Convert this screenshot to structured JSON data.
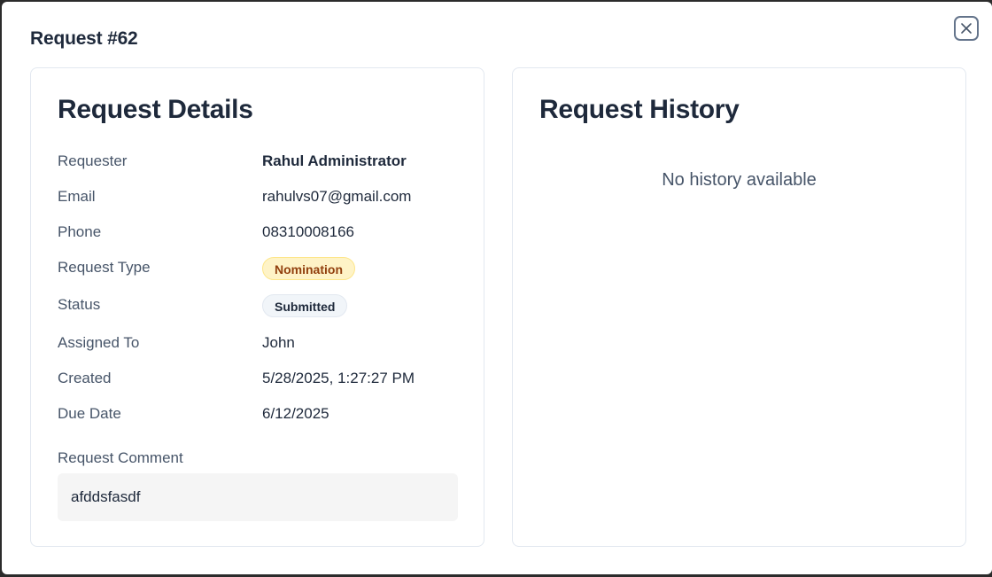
{
  "modal": {
    "title": "Request #62",
    "close_icon": "close-icon"
  },
  "details": {
    "title": "Request Details",
    "rows": [
      {
        "label": "Requester",
        "value": "Rahul Administrator"
      },
      {
        "label": "Email",
        "value": "rahulvs07@gmail.com"
      },
      {
        "label": "Phone",
        "value": "08310008166"
      },
      {
        "label": "Request Type",
        "value": "Nomination"
      },
      {
        "label": "Status",
        "value": "Submitted"
      },
      {
        "label": "Assigned To",
        "value": "John"
      },
      {
        "label": "Created",
        "value": "5/28/2025, 1:27:27 PM"
      },
      {
        "label": "Due Date",
        "value": "6/12/2025"
      }
    ],
    "comment_label": "Request Comment",
    "comment_value": "afddsfasdf"
  },
  "history": {
    "title": "Request History",
    "empty_text": "No history available"
  },
  "colors": {
    "text_primary": "#1e293b",
    "text_secondary": "#475569",
    "badge_nomination_bg": "#fef3c7",
    "badge_nomination_text": "#92400e",
    "badge_status_bg": "#f1f5f9"
  }
}
